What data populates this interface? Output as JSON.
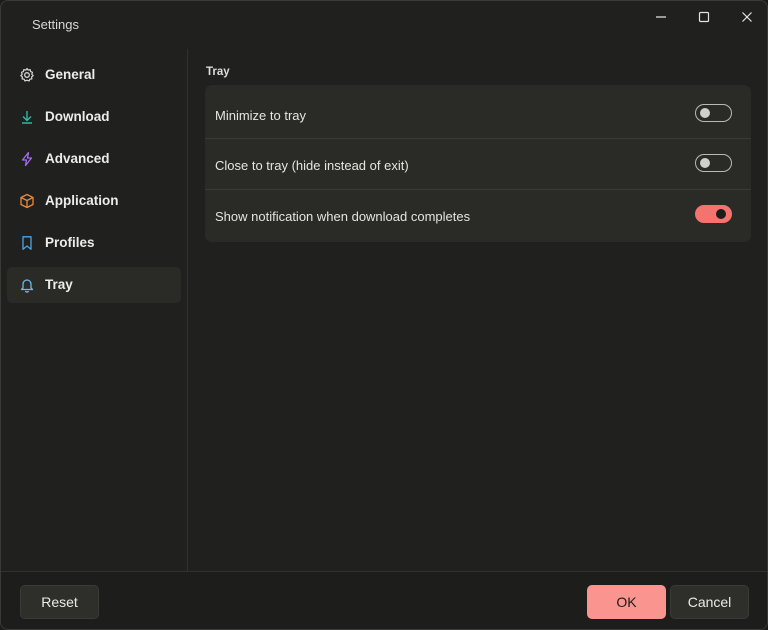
{
  "window": {
    "title": "Settings"
  },
  "sidebar": {
    "items": [
      {
        "label": "General",
        "icon": "gear-icon",
        "icon_color": "#d6d6d2",
        "active": false
      },
      {
        "label": "Download",
        "icon": "download-icon",
        "icon_color": "#2fb7a4",
        "active": false
      },
      {
        "label": "Advanced",
        "icon": "lightning-icon",
        "icon_color": "#a36bf0",
        "active": false
      },
      {
        "label": "Application",
        "icon": "box-icon",
        "icon_color": "#e9893a",
        "active": false
      },
      {
        "label": "Profiles",
        "icon": "bookmark-icon",
        "icon_color": "#4aa6e6",
        "active": false
      },
      {
        "label": "Tray",
        "icon": "bell-icon",
        "icon_color": "#6fb8ea",
        "active": true
      }
    ]
  },
  "content": {
    "section_title": "Tray",
    "settings": [
      {
        "label": "Minimize to tray",
        "enabled": false
      },
      {
        "label": "Close to tray (hide instead of exit)",
        "enabled": false
      },
      {
        "label": "Show notification when download completes",
        "enabled": true
      }
    ]
  },
  "footer": {
    "reset_label": "Reset",
    "ok_label": "OK",
    "cancel_label": "Cancel"
  },
  "colors": {
    "accent": "#f9948f",
    "toggle_on": "#f5736e",
    "background": "#20201e",
    "card": "#2a2a27"
  }
}
